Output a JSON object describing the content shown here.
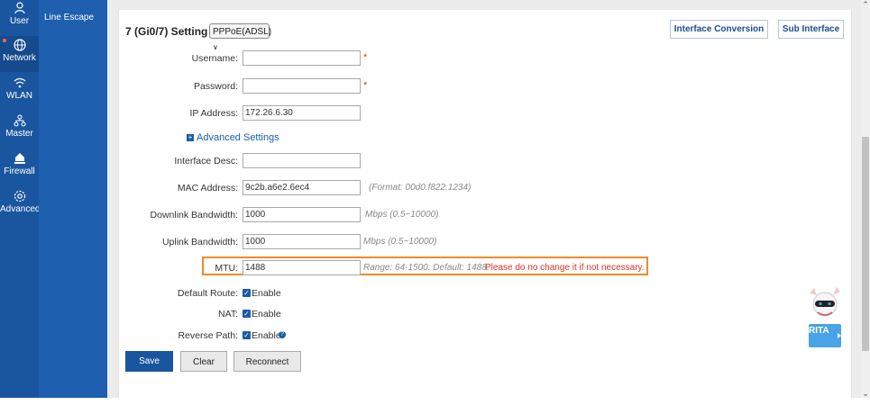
{
  "nav": {
    "items": [
      {
        "label": "User",
        "icon": "user-icon"
      },
      {
        "label": "Network",
        "icon": "network-icon",
        "active": true
      },
      {
        "label": "WLAN",
        "icon": "wifi-icon"
      },
      {
        "label": "Master",
        "icon": "master-icon"
      },
      {
        "label": "Firewall",
        "icon": "firewall-icon"
      },
      {
        "label": "Advanced",
        "icon": "gear-icon"
      }
    ],
    "sub_item": "Line Escape"
  },
  "header": {
    "title": "7 (Gi0/7) Setting",
    "mode_selected": "PPPoE(ADSL)",
    "interface_conversion": "Interface Conversion",
    "sub_interface": "Sub Interface"
  },
  "form": {
    "username": {
      "label": "Username:",
      "value": "",
      "required": "*"
    },
    "password": {
      "label": "Password:",
      "value": "",
      "required": "*"
    },
    "ip": {
      "label": "IP Address:",
      "value": "172.26.6.30"
    },
    "advanced_link": "Advanced Settings",
    "desc": {
      "label": "Interface Desc:",
      "value": ""
    },
    "mac": {
      "label": "MAC Address:",
      "value": "9c2b.a6e2.6ec4",
      "hint": "(Format: 00d0.f822.1234)"
    },
    "downlink": {
      "label": "Downlink Bandwidth:",
      "value": "1000",
      "hint": "Mbps (0.5~10000)"
    },
    "uplink": {
      "label": "Uplink Bandwidth:",
      "value": "1000",
      "hint": "Mbps (0.5~10000)"
    },
    "mtu": {
      "label": "MTU:",
      "value": "1488",
      "hint": "Range: 64-1500. Default: 1488.",
      "warning": "Please do no change it if not necessary."
    },
    "default_route": {
      "label": "Default Route:",
      "option": "Enable",
      "checked": true
    },
    "nat": {
      "label": "NAT:",
      "option": "Enable",
      "checked": true
    },
    "reverse_path": {
      "label": "Reverse Path:",
      "option": "Enable",
      "checked": true
    }
  },
  "buttons": {
    "save": "Save",
    "clear": "Clear",
    "reconnect": "Reconnect"
  },
  "assistant": {
    "label": "RITA"
  },
  "colors": {
    "nav": "#1a56a0",
    "accent": "#1a56a0",
    "highlight": "#f08a28",
    "warning": "#e0301e"
  }
}
